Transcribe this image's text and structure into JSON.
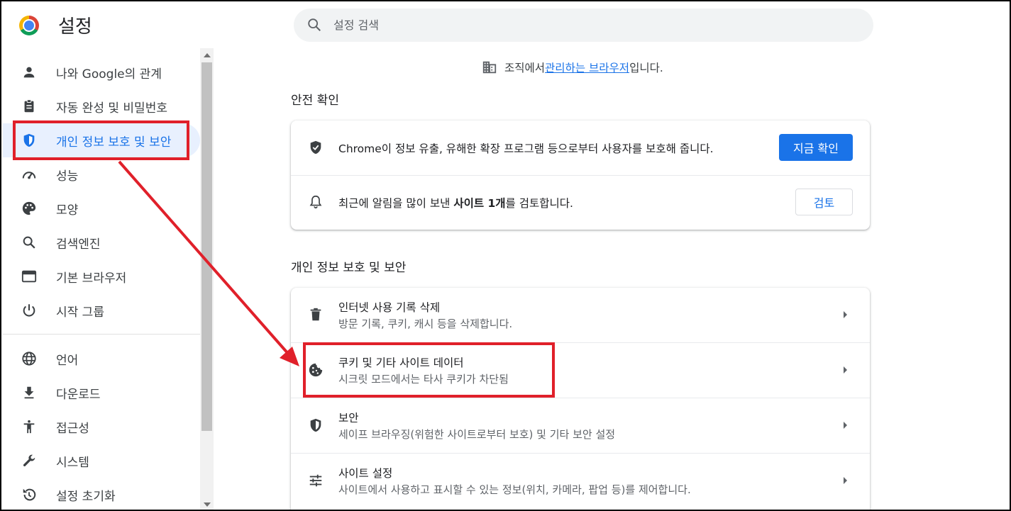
{
  "header": {
    "title": "설정",
    "search_placeholder": "설정 검색"
  },
  "sidebar": {
    "items": [
      {
        "label": "나와 Google의 관계",
        "icon": "person-icon"
      },
      {
        "label": "자동 완성 및 비밀번호",
        "icon": "clipboard-icon"
      },
      {
        "label": "개인 정보 보호 및 보안",
        "icon": "shield-icon",
        "active": true
      },
      {
        "label": "성능",
        "icon": "speedometer-icon"
      },
      {
        "label": "모양",
        "icon": "palette-icon"
      },
      {
        "label": "검색엔진",
        "icon": "search-icon"
      },
      {
        "label": "기본 브라우저",
        "icon": "browser-window-icon"
      },
      {
        "label": "시작 그룹",
        "icon": "power-icon"
      },
      {
        "label": "언어",
        "icon": "globe-icon"
      },
      {
        "label": "다운로드",
        "icon": "download-icon"
      },
      {
        "label": "접근성",
        "icon": "accessibility-icon"
      },
      {
        "label": "시스템",
        "icon": "wrench-icon"
      },
      {
        "label": "설정 초기화",
        "icon": "reset-icon"
      }
    ]
  },
  "managed": {
    "prefix": "조직에서 ",
    "link": "관리하는 브라우저",
    "suffix": "입니다."
  },
  "safety_check": {
    "title": "안전 확인",
    "row1_text": "Chrome이 정보 유출, 유해한 확장 프로그램 등으로부터 사용자를 보호해 줍니다.",
    "row1_button": "지금 확인",
    "row2_prefix": "최근에 알림을 많이 보낸 ",
    "row2_bold": "사이트 1개",
    "row2_suffix": "를 검토합니다.",
    "row2_button": "검토"
  },
  "privacy": {
    "title": "개인 정보 보호 및 보안",
    "rows": [
      {
        "title": "인터넷 사용 기록 삭제",
        "sub": "방문 기록, 쿠키, 캐시 등을 삭제합니다.",
        "icon": "trash-icon"
      },
      {
        "title": "쿠키 및 기타 사이트 데이터",
        "sub": "시크릿 모드에서는 타사 쿠키가 차단됨",
        "icon": "cookie-icon"
      },
      {
        "title": "보안",
        "sub": "세이프 브라우징(위험한 사이트로부터 보호) 및 기타 보안 설정",
        "icon": "shield-icon"
      },
      {
        "title": "사이트 설정",
        "sub": "사이트에서 사용하고 표시할 수 있는 정보(위치, 카메라, 팝업 등)를 제어합니다.",
        "icon": "tune-icon"
      }
    ]
  },
  "colors": {
    "accent": "#1a73e8",
    "annotation": "#e0202a"
  }
}
